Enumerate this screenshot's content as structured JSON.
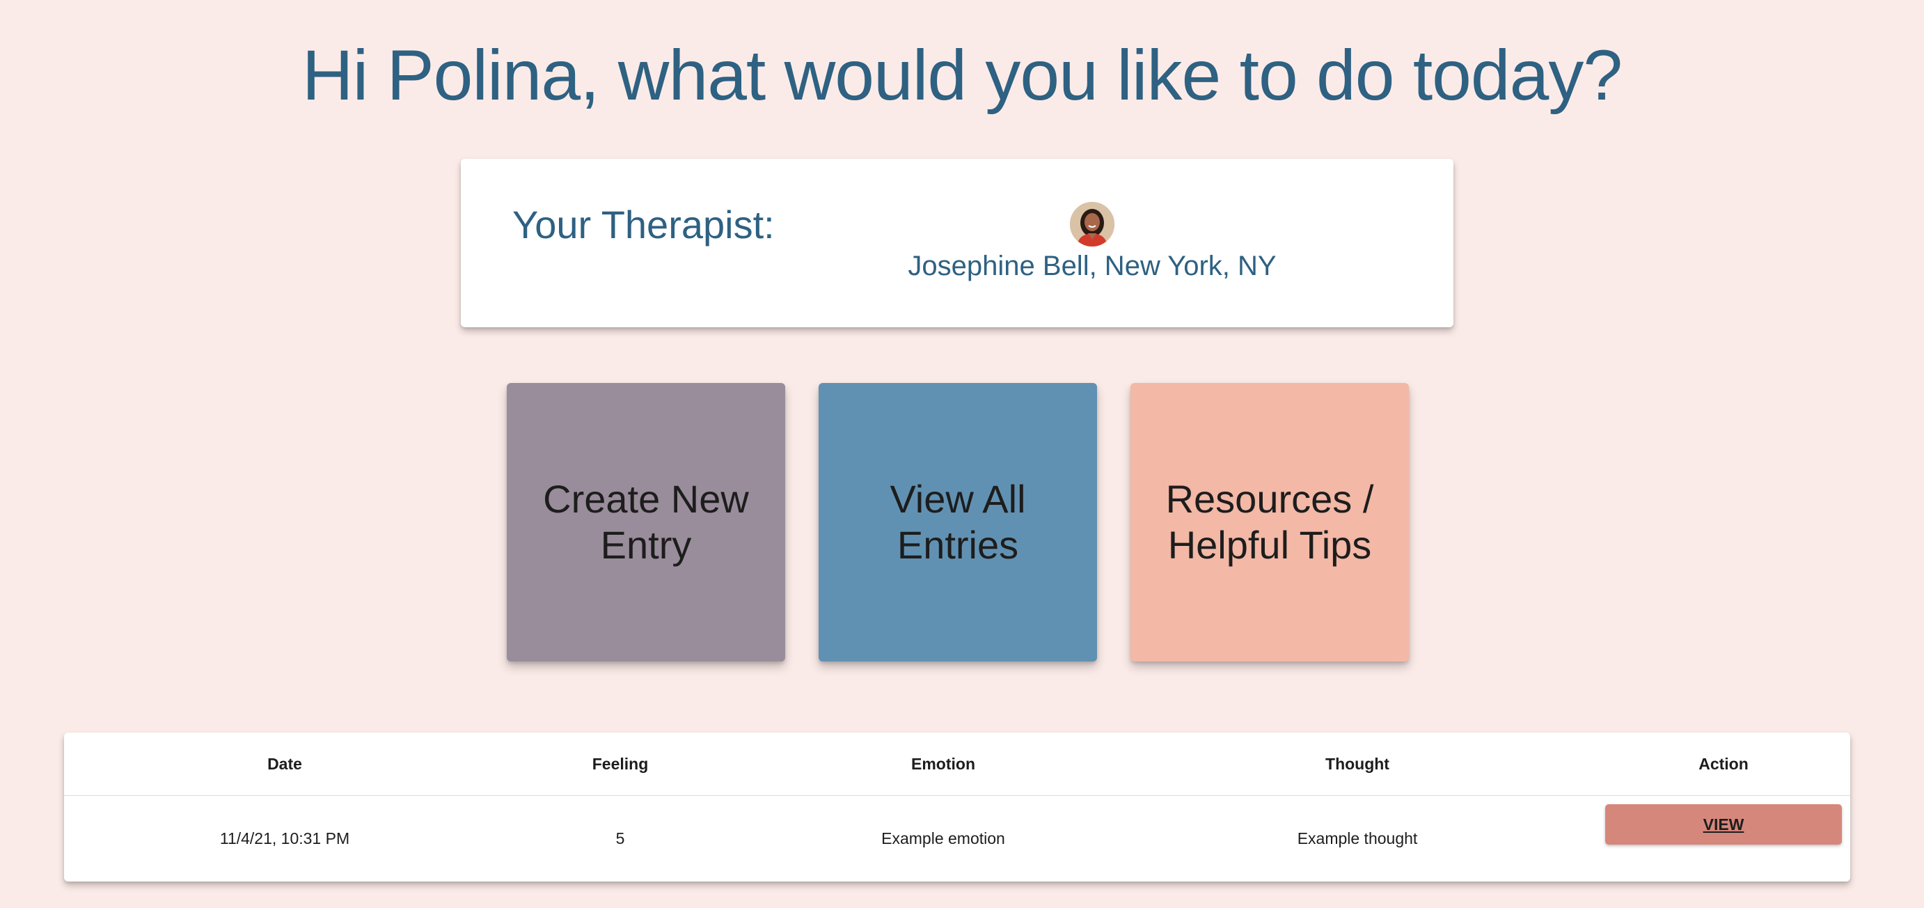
{
  "greeting": "Hi Polina, what would you like to do today?",
  "therapist": {
    "label": "Your Therapist:",
    "name": "Josephine Bell, New York, NY",
    "avatar_icon": "therapist-avatar"
  },
  "tiles": [
    {
      "label": "Create New Entry",
      "color": "#9a8d9b"
    },
    {
      "label": "View All Entries",
      "color": "#6191b2"
    },
    {
      "label": "Resources / Helpful Tips",
      "color": "#f3b8a6"
    }
  ],
  "table": {
    "headers": {
      "date": "Date",
      "feeling": "Feeling",
      "emotion": "Emotion",
      "thought": "Thought",
      "action": "Action"
    },
    "rows": [
      {
        "date": "11/4/21, 10:31 PM",
        "feeling": "5",
        "emotion": "Example emotion",
        "thought": "Example thought",
        "action_label": "VIEW"
      }
    ]
  },
  "colors": {
    "background": "#fbebe8",
    "primary_text": "#2e6182",
    "view_button": "#d6877b"
  }
}
